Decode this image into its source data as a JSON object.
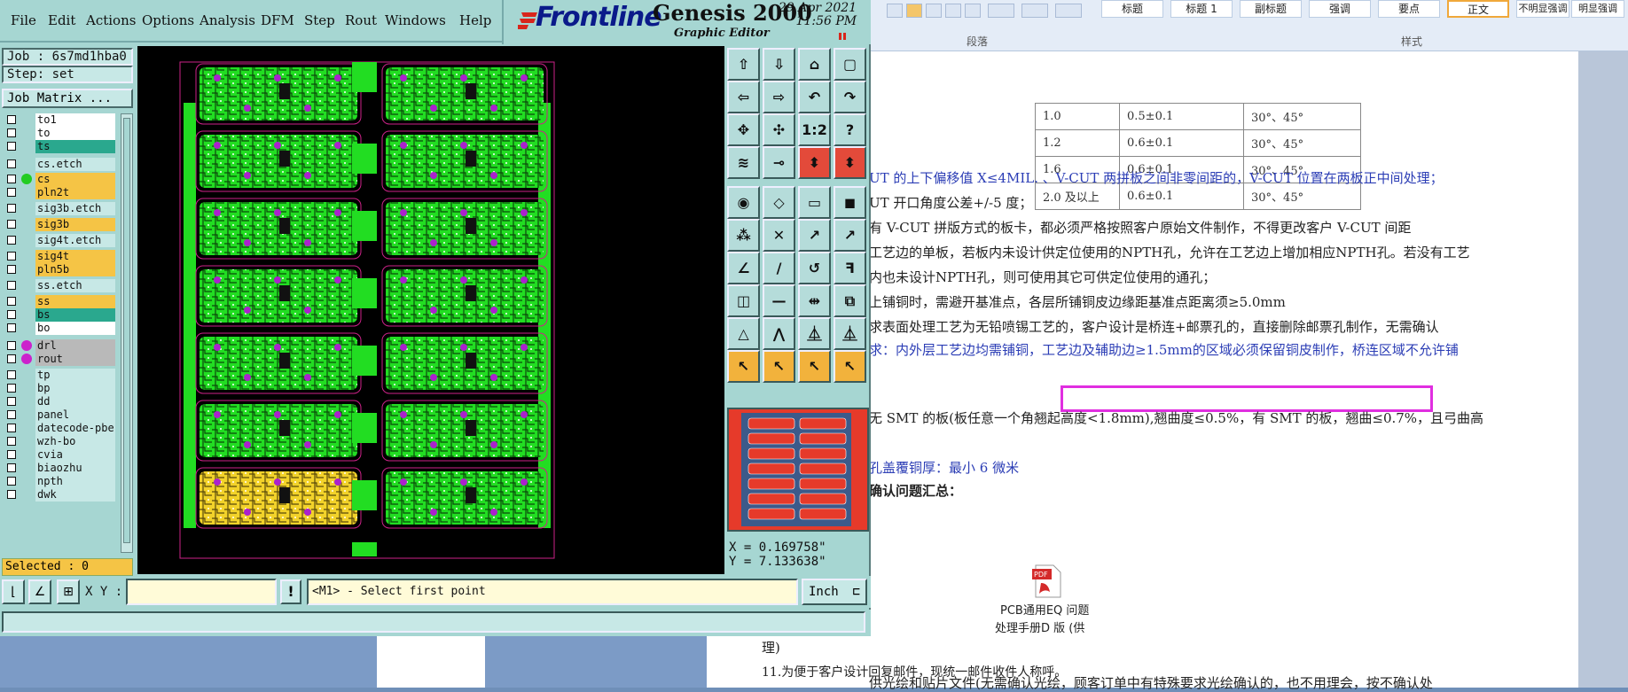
{
  "menu": [
    "File",
    "Edit",
    "Actions",
    "Options",
    "Analysis",
    "DFM",
    "Step",
    "Rout",
    "Windows",
    "Help"
  ],
  "brand": {
    "logo": "Frontline",
    "title": "Genesis 2000",
    "date": "29 Apr 2021",
    "time": "11:56 PM",
    "subtitle": "Graphic Editor"
  },
  "job": {
    "job_label": "Job : 6s7md1hba0",
    "step_label": "Step: set",
    "matrix_button": "Job Matrix ..."
  },
  "layers": [
    {
      "name": "to1",
      "color": "#ffffff",
      "dot": ""
    },
    {
      "name": "to",
      "color": "#ffffff",
      "dot": ""
    },
    {
      "name": "ts",
      "color": "#2aa88e",
      "dot": ""
    },
    {
      "name": "cs.etch",
      "color": "#c7e8e6",
      "dot": ""
    },
    {
      "name": "cs",
      "color": "#f5c445",
      "dot": "#22cc22"
    },
    {
      "name": "pln2t",
      "color": "#f5c445",
      "dot": ""
    },
    {
      "name": "sig3b.etch",
      "color": "#c7e8e6",
      "dot": ""
    },
    {
      "name": "sig3b",
      "color": "#f5c445",
      "dot": ""
    },
    {
      "name": "sig4t.etch",
      "color": "#c7e8e6",
      "dot": ""
    },
    {
      "name": "sig4t",
      "color": "#f5c445",
      "dot": ""
    },
    {
      "name": "pln5b",
      "color": "#f5c445",
      "dot": ""
    },
    {
      "name": "ss.etch",
      "color": "#c7e8e6",
      "dot": ""
    },
    {
      "name": "ss",
      "color": "#f5c445",
      "dot": ""
    },
    {
      "name": "bs",
      "color": "#2aa88e",
      "dot": ""
    },
    {
      "name": "bo",
      "color": "#ffffff",
      "dot": ""
    },
    {
      "name": "drl",
      "color": "#b9b9b9",
      "dot": "#cc22cc"
    },
    {
      "name": "rout",
      "color": "#b9b9b9",
      "dot": "#cc22cc"
    },
    {
      "name": "tp",
      "color": "#c7e8e6",
      "dot": ""
    },
    {
      "name": "bp",
      "color": "#c7e8e6",
      "dot": ""
    },
    {
      "name": "dd",
      "color": "#c7e8e6",
      "dot": ""
    },
    {
      "name": "panel",
      "color": "#c7e8e6",
      "dot": ""
    },
    {
      "name": "datecode-pbe",
      "color": "#c7e8e6",
      "dot": ""
    },
    {
      "name": "wzh-bo",
      "color": "#c7e8e6",
      "dot": ""
    },
    {
      "name": "cvia",
      "color": "#c7e8e6",
      "dot": ""
    },
    {
      "name": "biaozhu",
      "color": "#c7e8e6",
      "dot": ""
    },
    {
      "name": "npth",
      "color": "#c7e8e6",
      "dot": ""
    },
    {
      "name": "dwk",
      "color": "#c7e8e6",
      "dot": ""
    }
  ],
  "selected": "Selected : 0",
  "coords": {
    "x": "X = 0.169758\"",
    "y": "Y = 7.133638\""
  },
  "bottom": {
    "xy_label": "X Y :",
    "message": "<M1> - Select first point",
    "unit": "Inch"
  },
  "tools": [
    "⇧",
    "⇩",
    "⌂",
    "▢",
    "⇦",
    "⇨",
    "↶",
    "↷",
    "✥",
    "✣",
    "1:2",
    "?",
    "≋",
    "⊸",
    "⬍",
    "⬍",
    "◉",
    "◇",
    "▭",
    "◼",
    "⁂",
    "✕",
    "↗",
    "↗",
    "∠",
    "/",
    "↺",
    "ꟻ",
    "◫",
    "—",
    "⇹",
    "⧉",
    "△",
    "⋀",
    "⏅",
    "⏅",
    "↖",
    "↖",
    "↖",
    "↖"
  ],
  "word": {
    "styles": [
      "标题",
      "标题 1",
      "副标题",
      "强调",
      "要点",
      "正文",
      "不明显强调",
      "明显强调"
    ],
    "group_para": "段落",
    "group_style": "样式",
    "table": [
      [
        "1.0",
        "0.5±0.1",
        "30°、45°"
      ],
      [
        "1.2",
        "0.6±0.1",
        "30°、45°"
      ],
      [
        "1.6",
        "0.6±0.1",
        "30°、45°"
      ],
      [
        "2.0 及以上",
        "0.6±0.1",
        "30°、45°"
      ]
    ],
    "lines": [
      "UT 的上下偏移值 X≤4MIL. 、V-CUT 两拼板之间非零间距的，V-CUT  位置在两板正中间处理；",
      "UT 开口角度公差+/-5 度；",
      "有 V-CUT 拼版方式的板卡，都必须严格按照客户原始文件制作，不得更改客户 V-CUT 间距",
      "工艺边的单板，若板内未设计供定位使用的NPTH孔，允许在工艺边上增加相应NPTH孔。若没有工艺",
      "内也未设计NPTH孔，则可使用其它可供定位使用的通孔；",
      "上铺铜时，需避开基准点，各层所铺铜皮边缘距基准点距离须≥5.0mm",
      "求表面处理工艺为无铅喷锡工艺的，客户设计是桥连+邮票孔的，直接删除邮票孔制作，无需确认",
      "求：内外层工艺边均需铺铜，工艺边及辅助边≥1.5mm的区域必须保留铜皮制作，桥连区域不允许铺",
      "无 SMT 的板(板任意一个角翘起高度<1.8mm),翘曲度≤0.5%，有 SMT 的板，翘曲≤0.7%，且弓曲高",
      "孔盖覆铜厚：最小 6 微米",
      "确认问题汇总：",
      "供光绘和贴片文件(无需确认光绘，顾客订单中有特殊要求光绘确认的，也不用理会，按不确认处",
      "理)",
      "11.为便于客户设计回复邮件，现统一邮件收件人称呼。"
    ],
    "pdf_caption_1": "PCB通用EQ 问题",
    "pdf_caption_2": "处理手册D 版 (供"
  }
}
